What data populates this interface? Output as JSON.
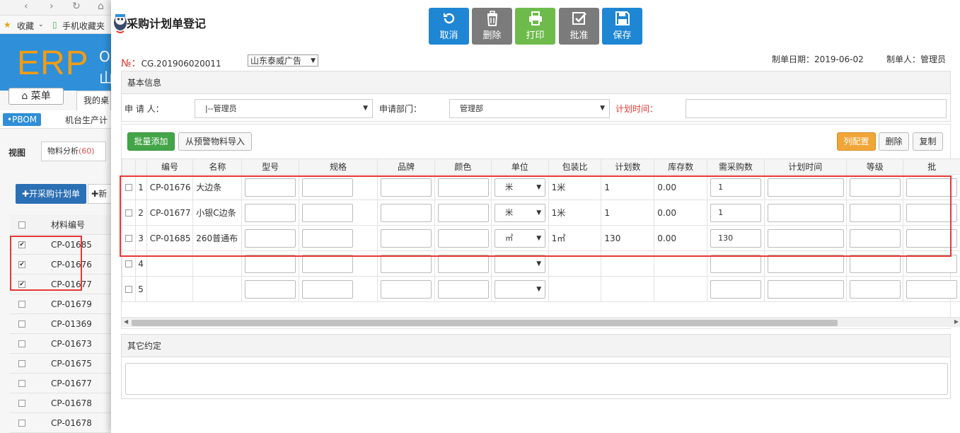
{
  "background": {
    "fav_bookmark": "收藏",
    "fav_mobile": "手机收藏夹",
    "logo": "ERP",
    "company_o": "O",
    "company_m": "山",
    "menu": "菜单",
    "desktop_tab": "我的桌",
    "pbom": "•PBOM",
    "nav_item": "机台生产计",
    "view_label": "视图",
    "material_analysis": "物料分析",
    "material_count": "(60)",
    "open_plan": "开采购计划单",
    "new_btn": "新",
    "list_header": "材料编号",
    "list_rows": [
      {
        "code": "CP-01685",
        "checked": true
      },
      {
        "code": "CP-01676",
        "checked": true
      },
      {
        "code": "CP-01677",
        "checked": true
      },
      {
        "code": "CP-01679",
        "checked": false
      },
      {
        "code": "CP-01369",
        "checked": false
      },
      {
        "code": "CP-01673",
        "checked": false
      },
      {
        "code": "CP-01675",
        "checked": false
      },
      {
        "code": "CP-01677",
        "checked": false
      },
      {
        "code": "CP-01678",
        "checked": false
      },
      {
        "code": "CP-01678",
        "checked": false
      }
    ]
  },
  "dialog": {
    "title": "采购计划单登记",
    "toolbar": {
      "cancel": "取消",
      "delete": "删除",
      "print": "打印",
      "approve": "批准",
      "save": "保存"
    },
    "number_prefix": "№：",
    "number": "CG.201906020011",
    "supplier": "山东泰威广告",
    "date_label": "制单日期：2019-06-02",
    "maker_label": "制单人：管理员",
    "basic_info": {
      "header": "基本信息",
      "applicant_label": "申 请 人：",
      "applicant_value": "|--管理员",
      "dept_label": "申请部门：",
      "dept_value": "管理部",
      "plan_time_label": "计划时间："
    },
    "grid": {
      "batch_add": "批量添加",
      "import_warning": "从预警物料导入",
      "column_config": "列配置",
      "delete": "删除",
      "copy": "复制",
      "columns": [
        "",
        "",
        "编号",
        "名称",
        "型号",
        "规格",
        "品牌",
        "颜色",
        "单位",
        "包装比",
        "计划数",
        "库存数",
        "需采购数",
        "计划时间",
        "等级",
        "批"
      ],
      "rows": [
        {
          "idx": "1",
          "code": "CP-01676",
          "name": "大边条",
          "unit": "米",
          "pack": "1米",
          "plan": "1",
          "stock": "0.00",
          "need": "1"
        },
        {
          "idx": "2",
          "code": "CP-01677",
          "name": "小银C边条",
          "unit": "米",
          "pack": "1米",
          "plan": "1",
          "stock": "0.00",
          "need": "1"
        },
        {
          "idx": "3",
          "code": "CP-01685",
          "name": "260普通布",
          "unit": "㎡",
          "pack": "1㎡",
          "plan": "130",
          "stock": "0.00",
          "need": "130"
        },
        {
          "idx": "4",
          "code": "",
          "name": "",
          "unit": "",
          "pack": "",
          "plan": "",
          "stock": "",
          "need": ""
        },
        {
          "idx": "5",
          "code": "",
          "name": "",
          "unit": "",
          "pack": "",
          "plan": "",
          "stock": "",
          "need": ""
        }
      ]
    },
    "other_terms": {
      "header": "其它约定"
    }
  },
  "colors": {
    "blue_btn": "#1f86d4",
    "gray_btn": "#7b7b7b",
    "green_btn": "#6dbb4b",
    "orange_btn": "#f0a637",
    "highlight": "#e53935"
  }
}
